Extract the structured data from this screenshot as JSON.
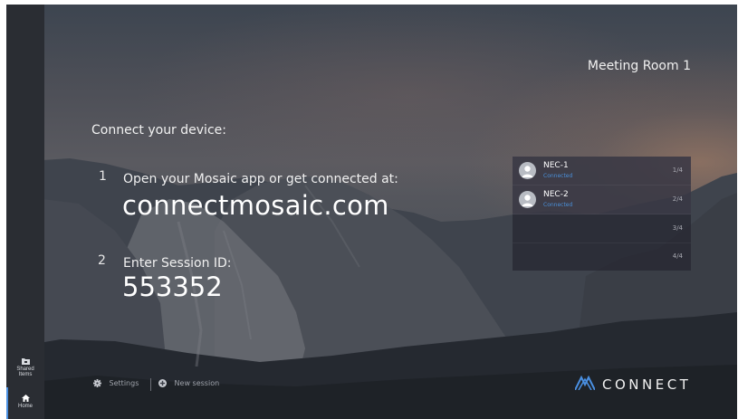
{
  "room": {
    "name": "Meeting Room 1"
  },
  "connect": {
    "heading": "Connect your device:",
    "step1": {
      "number": "1",
      "text": "Open your Mosaic app or get connected at:",
      "url": "connectmosaic.com"
    },
    "step2": {
      "number": "2",
      "text": "Enter Session ID:",
      "session_id": "553352"
    }
  },
  "devices": [
    {
      "name": "NEC-1",
      "status": "Connected",
      "slot": "1/4"
    },
    {
      "name": "NEC-2",
      "status": "Connected",
      "slot": "2/4"
    },
    {
      "name": "",
      "status": "",
      "slot": "3/4"
    },
    {
      "name": "",
      "status": "",
      "slot": "4/4"
    }
  ],
  "sidebar": {
    "shared_items": {
      "label_line1": "Shared",
      "label_line2": "Items",
      "icon": "folder-icon"
    },
    "home": {
      "label": "Home",
      "icon": "home-icon"
    }
  },
  "footer": {
    "settings_label": "Settings",
    "settings_icon": "gear-icon",
    "new_session_label": "New session",
    "new_session_icon": "plus-circle-icon"
  },
  "brand": {
    "name": "CONNECT",
    "color": "#4a90e2"
  },
  "colors": {
    "accent": "#4a90e2",
    "connected_status": "#4a8fd8"
  }
}
